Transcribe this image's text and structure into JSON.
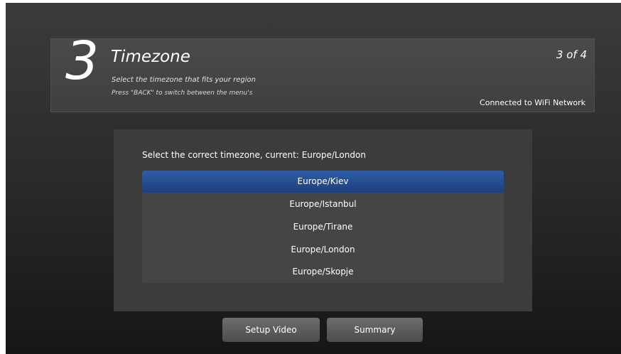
{
  "header": {
    "step_number": "3",
    "title": "Timezone",
    "description": "Select the timezone that fits your region",
    "hint": "Press \"BACK\" to switch between the menu's",
    "counter": "3 of 4",
    "wifi_status": "Connected to WiFi Network"
  },
  "panel": {
    "label": "Select the correct timezone, current: Europe/London",
    "selected_index": 0,
    "items": [
      {
        "label": "Europe/Kiev"
      },
      {
        "label": "Europe/Istanbul"
      },
      {
        "label": "Europe/Tirane"
      },
      {
        "label": "Europe/London"
      },
      {
        "label": "Europe/Skopje"
      }
    ]
  },
  "buttons": {
    "setup_video": "Setup Video",
    "summary": "Summary"
  },
  "colors": {
    "selection": "#2d5da8",
    "background": "#2c2c2c",
    "panel": "#3c3c3c"
  }
}
